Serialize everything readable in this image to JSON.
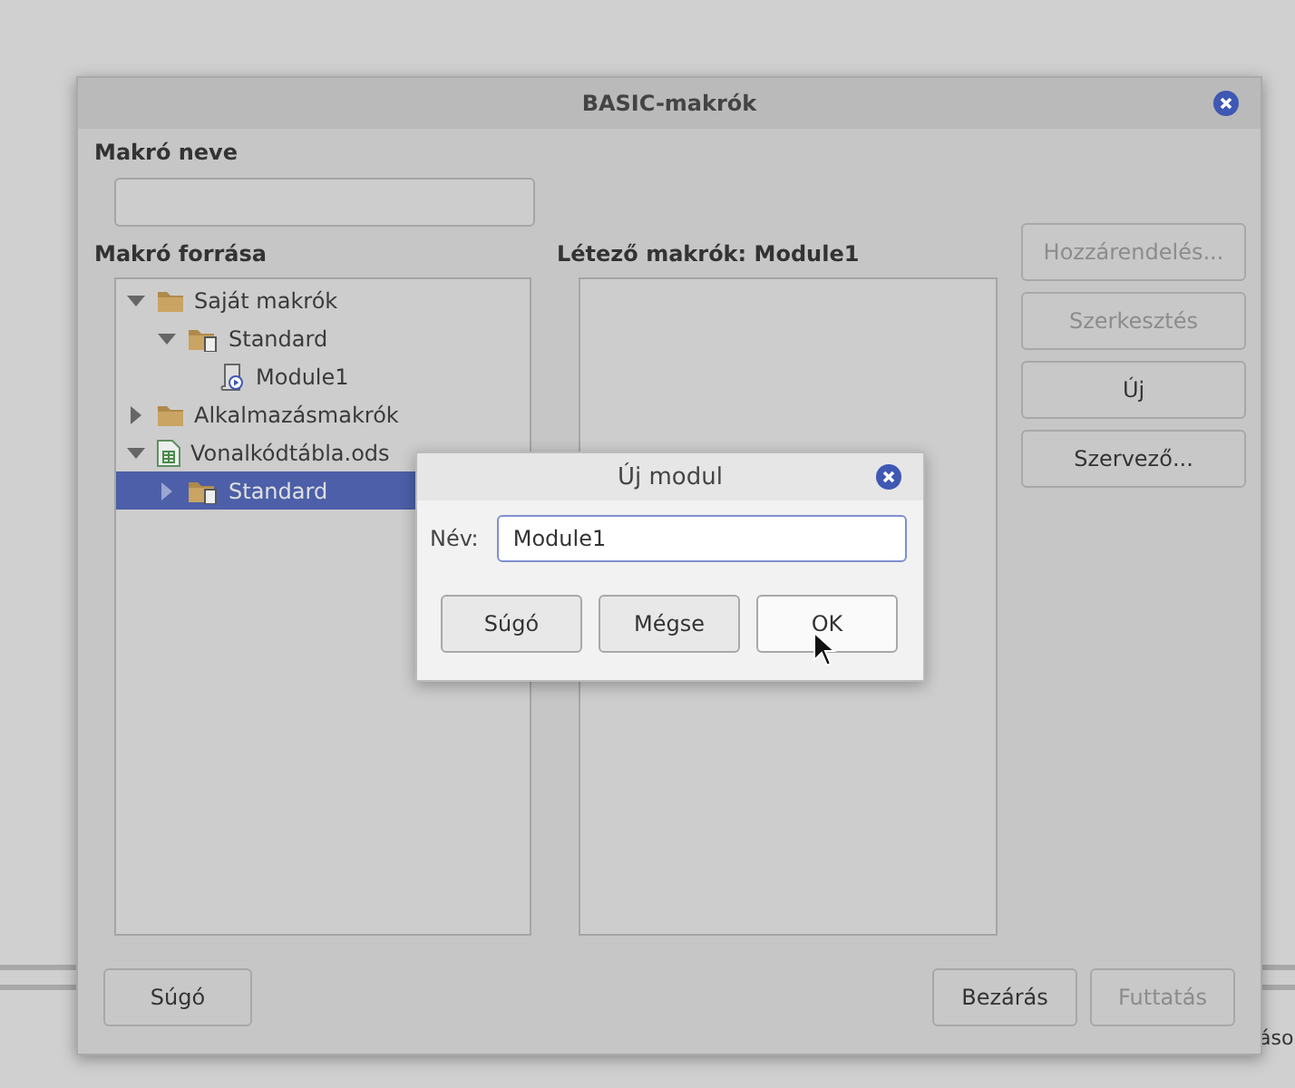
{
  "background_text": "áso",
  "main_dialog": {
    "title": "BASIC-makrók",
    "name_label": "Makró neve",
    "source_label": "Makró forrása",
    "tree": [
      {
        "label": "Saját makrók",
        "kind": "folder",
        "expanded": true,
        "selected": false,
        "children": [
          {
            "label": "Standard",
            "kind": "library",
            "expanded": true,
            "selected": false,
            "children": [
              {
                "label": "Module1",
                "kind": "module",
                "selected": false
              }
            ]
          }
        ]
      },
      {
        "label": "Alkalmazásmakrók",
        "kind": "folder",
        "expanded": false,
        "selected": false
      },
      {
        "label": "Vonalkódtábla.ods",
        "kind": "document",
        "expanded": true,
        "selected": false,
        "children": [
          {
            "label": "Standard",
            "kind": "library",
            "expanded": false,
            "selected": true
          }
        ]
      }
    ],
    "existing_label": "Létező makrók: Module1",
    "side_buttons": [
      {
        "label": "Hozzárendelés...",
        "disabled": true
      },
      {
        "label": "Szerkesztés",
        "disabled": true
      },
      {
        "label": "Új",
        "disabled": false
      },
      {
        "label": "Szervező...",
        "disabled": false
      }
    ],
    "help_button": "Súgó",
    "bottom_buttons": [
      {
        "label": "Bezárás",
        "disabled": false
      },
      {
        "label": "Futtatás",
        "disabled": true
      }
    ]
  },
  "modal": {
    "title": "Új modul",
    "name_label": "Név:",
    "name_value": "Module1",
    "buttons": [
      {
        "label": "Súgó",
        "focused": false
      },
      {
        "label": "Mégse",
        "focused": false
      },
      {
        "label": "OK",
        "focused": true
      }
    ]
  }
}
